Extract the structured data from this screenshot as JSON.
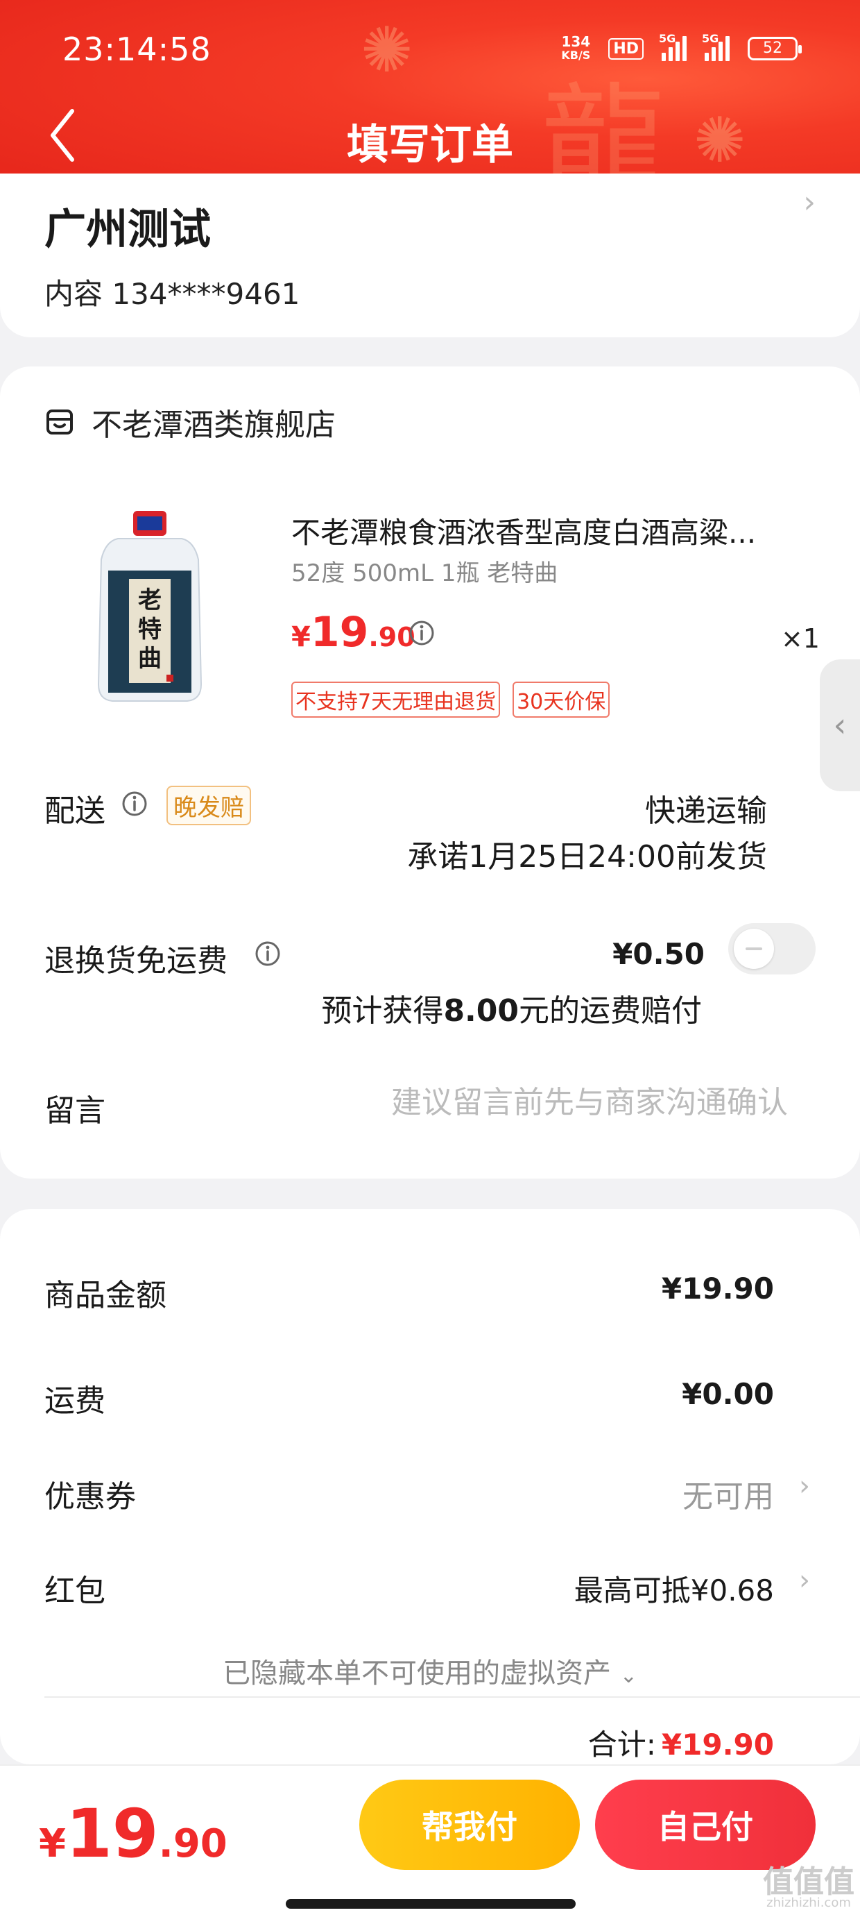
{
  "status_bar": {
    "time": "23:14:58",
    "net_speed_value": "134",
    "net_speed_unit": "KB/S",
    "hd": "HD",
    "signal1_tag": "5G",
    "signal2_tag": "5G",
    "battery": "52"
  },
  "header": {
    "title": "填写订单"
  },
  "address": {
    "name": "广州测试",
    "contact": "内容  134****9461"
  },
  "shop": {
    "name": "不老潭酒类旗舰店"
  },
  "product": {
    "title": "不老潭粮食酒浓香型高度白酒高粱...",
    "spec": "52度 500mL 1瓶 老特曲",
    "price_currency": "¥",
    "price_int": "19",
    "price_dec": ".90",
    "quantity": "×1",
    "tags": [
      "不支持7天无理由退货",
      "30天价保"
    ],
    "label_text": "老特曲"
  },
  "delivery": {
    "label": "配送",
    "badge": "晚发赔",
    "method": "快递运输",
    "promise": "承诺1月25日24:00前发货"
  },
  "return_shipping": {
    "label": "退换货免运费",
    "price": "¥0.50",
    "compensation_prefix": "预计获得",
    "compensation_amount": "8.00",
    "compensation_suffix": "元的运费赔付",
    "enabled": false
  },
  "message": {
    "label": "留言",
    "placeholder": "建议留言前先与商家沟通确认"
  },
  "summary": {
    "goods_label": "商品金额",
    "goods_value": "¥19.90",
    "shipping_label": "运费",
    "shipping_value": "¥0.00",
    "coupon_label": "优惠券",
    "coupon_value": "无可用",
    "redpacket_label": "红包",
    "redpacket_value": "最高可抵¥0.68",
    "hidden_assets": "已隐藏本单不可使用的虚拟资产",
    "total_label": "合计:",
    "total_value": "¥19.90"
  },
  "bottom": {
    "price_currency": "¥",
    "price_int": "19",
    "price_dec": ".90",
    "help_pay_label": "帮我付",
    "self_pay_label": "自己付"
  },
  "watermark": {
    "main": "值值值",
    "sub": "zhizhizhi.com"
  },
  "colors": {
    "header_red": "#e5241a",
    "price_red": "#f02a2a",
    "help_yellow": "#ffb200",
    "self_red": "#f0303a"
  }
}
